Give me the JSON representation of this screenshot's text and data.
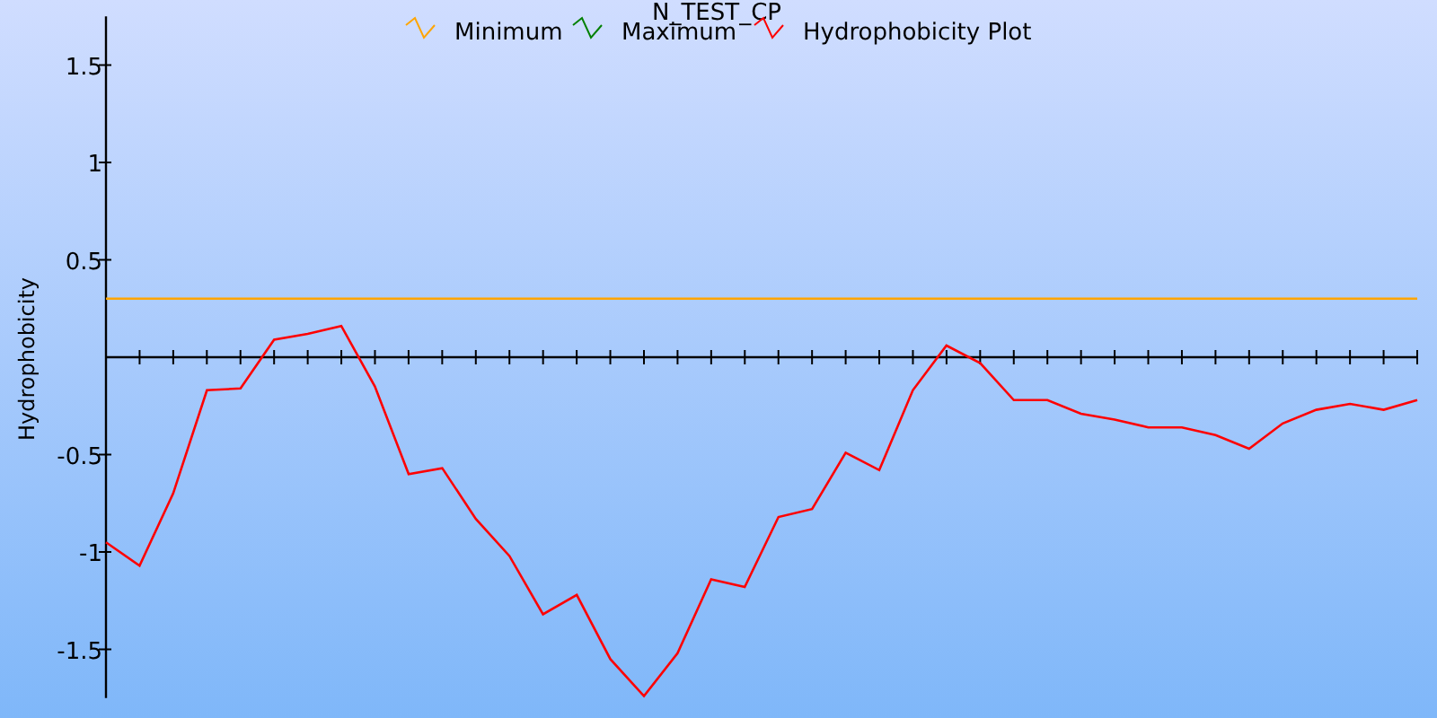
{
  "chart": {
    "title": "N_TEST_CP",
    "chart_data": {
      "type": "line",
      "ylabel": "Hydrophobicity",
      "ylim": [
        -1.75,
        1.75
      ],
      "yticks": [
        -1.5,
        -1,
        -0.5,
        0.5,
        1,
        1.5
      ],
      "legend": true,
      "series": [
        {
          "name": "Minimum",
          "color": "#ffa500",
          "values": [
            0.3,
            0.3,
            0.3,
            0.3,
            0.3,
            0.3,
            0.3,
            0.3,
            0.3,
            0.3,
            0.3,
            0.3,
            0.3,
            0.3,
            0.3,
            0.3,
            0.3,
            0.3,
            0.3,
            0.3,
            0.3,
            0.3,
            0.3,
            0.3,
            0.3,
            0.3,
            0.3,
            0.3,
            0.3,
            0.3,
            0.3,
            0.3,
            0.3,
            0.3,
            0.3,
            0.3,
            0.3,
            0.3,
            0.3,
            0.3
          ]
        },
        {
          "name": "Maximum",
          "color": "#008000",
          "values": [
            null,
            null,
            null,
            null,
            null,
            null,
            null,
            null,
            null,
            null,
            null,
            null,
            null,
            null,
            null,
            null,
            null,
            null,
            null,
            null,
            null,
            null,
            null,
            null,
            null,
            null,
            null,
            null,
            null,
            null,
            null,
            null,
            null,
            null,
            null,
            null,
            null,
            null,
            null,
            null
          ]
        },
        {
          "name": "Hydrophobicity Plot",
          "color": "#ff0000",
          "values": [
            -0.95,
            -1.07,
            -0.7,
            -0.17,
            -0.16,
            0.09,
            0.12,
            0.16,
            -0.15,
            -0.6,
            -0.57,
            -0.83,
            -1.02,
            -1.32,
            -1.22,
            -1.55,
            -1.74,
            -1.52,
            -1.14,
            -1.18,
            -0.82,
            -0.78,
            -0.49,
            -0.58,
            -0.17,
            0.06,
            -0.03,
            -0.22,
            -0.22,
            -0.29,
            -0.32,
            -0.36,
            -0.36,
            -0.4,
            -0.47,
            -0.34,
            -0.27,
            -0.24,
            -0.27,
            -0.22
          ]
        }
      ]
    }
  }
}
